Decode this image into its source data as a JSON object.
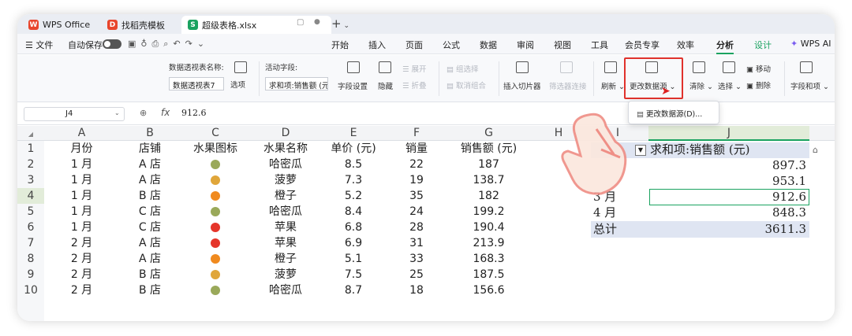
{
  "tabs": [
    {
      "label": "WPS Office",
      "icon": "wps-logo-icon",
      "color": "#e8452c"
    },
    {
      "label": "找稻壳模板",
      "icon": "docer-logo-icon",
      "color": "#e8452c"
    },
    {
      "label": "超级表格.xlsx",
      "icon": "sheet-file-icon",
      "color": "#1aa260"
    }
  ],
  "new_tab_label": "+",
  "menubar": {
    "file": "文件",
    "autosave": "自动保存",
    "items": [
      "开始",
      "插入",
      "页面",
      "公式",
      "数据",
      "审阅",
      "视图",
      "工具",
      "会员专享",
      "效率",
      "分析",
      "设计",
      "WPS AI"
    ],
    "active_item": "分析",
    "accent": "#1aa260"
  },
  "ribbon": {
    "pivot_name_label": "数据透视表名称:",
    "pivot_name_value": "数据透视表7",
    "options": "选项",
    "active_field_label": "活动字段:",
    "active_field_value": "求和项:销售额 (元)",
    "field_settings": "字段设置",
    "hide": "隐藏",
    "expand": "展开",
    "collapse": "折叠",
    "group_selection": "组选择",
    "ungroup": "取消组合",
    "insert_slicer": "插入切片器",
    "filter_connections": "筛选器连接",
    "refresh": "刷新",
    "change_source": "更改数据源",
    "clear": "清除",
    "select": "选择",
    "move": "移动",
    "delete": "删除",
    "field_list": "字段和项"
  },
  "dropdown": {
    "item": "更改数据源(D)..."
  },
  "formula_bar": {
    "name_box": "J4",
    "fx": "fx",
    "value": "912.6"
  },
  "columns": [
    "A",
    "B",
    "C",
    "D",
    "E",
    "F",
    "G",
    "H",
    "I",
    "J"
  ],
  "row_numbers": [
    "1",
    "2",
    "3",
    "4",
    "5",
    "6",
    "7",
    "8",
    "9",
    "10"
  ],
  "headers": [
    "月份",
    "店铺",
    "水果图标",
    "水果名称",
    "单价 (元)",
    "销量",
    "销售额 (元)"
  ],
  "rows": [
    {
      "month": "1 月",
      "store": "A 店",
      "icon": "melon-icon",
      "name": "哈密瓜",
      "price": "8.5",
      "qty": "22",
      "sales": "187"
    },
    {
      "month": "1 月",
      "store": "A 店",
      "icon": "pineapple-icon",
      "name": "菠萝",
      "price": "7.3",
      "qty": "19",
      "sales": "138.7"
    },
    {
      "month": "1 月",
      "store": "B 店",
      "icon": "orange-icon",
      "name": "橙子",
      "price": "5.2",
      "qty": "35",
      "sales": "182"
    },
    {
      "month": "1 月",
      "store": "C 店",
      "icon": "melon-icon",
      "name": "哈密瓜",
      "price": "8.4",
      "qty": "24",
      "sales": "199.2"
    },
    {
      "month": "1 月",
      "store": "C 店",
      "icon": "apple-icon",
      "name": "苹果",
      "price": "6.8",
      "qty": "28",
      "sales": "190.4"
    },
    {
      "month": "2 月",
      "store": "A 店",
      "icon": "apple-icon",
      "name": "苹果",
      "price": "6.9",
      "qty": "31",
      "sales": "213.9"
    },
    {
      "month": "2 月",
      "store": "A 店",
      "icon": "orange-icon",
      "name": "橙子",
      "price": "5.1",
      "qty": "33",
      "sales": "168.3"
    },
    {
      "month": "2 月",
      "store": "B 店",
      "icon": "pineapple-icon",
      "name": "菠萝",
      "price": "7.5",
      "qty": "25",
      "sales": "187.5"
    },
    {
      "month": "2 月",
      "store": "B 店",
      "icon": "melon-icon",
      "name": "哈密瓜",
      "price": "8.7",
      "qty": "18",
      "sales": "156.6"
    }
  ],
  "fruit_colors": {
    "melon": "#9aa95a",
    "pineapple": "#e0a63a",
    "orange": "#f08a1e",
    "apple": "#e5352a"
  },
  "pivot": {
    "header": "求和项:销售额 (元)",
    "rows": [
      {
        "label": "",
        "value": "897.3"
      },
      {
        "label": "",
        "value": "953.1"
      },
      {
        "label": "3 月",
        "value": "912.6"
      },
      {
        "label": "4 月",
        "value": "848.3"
      }
    ],
    "total_label": "总计",
    "total_value": "3611.3"
  }
}
